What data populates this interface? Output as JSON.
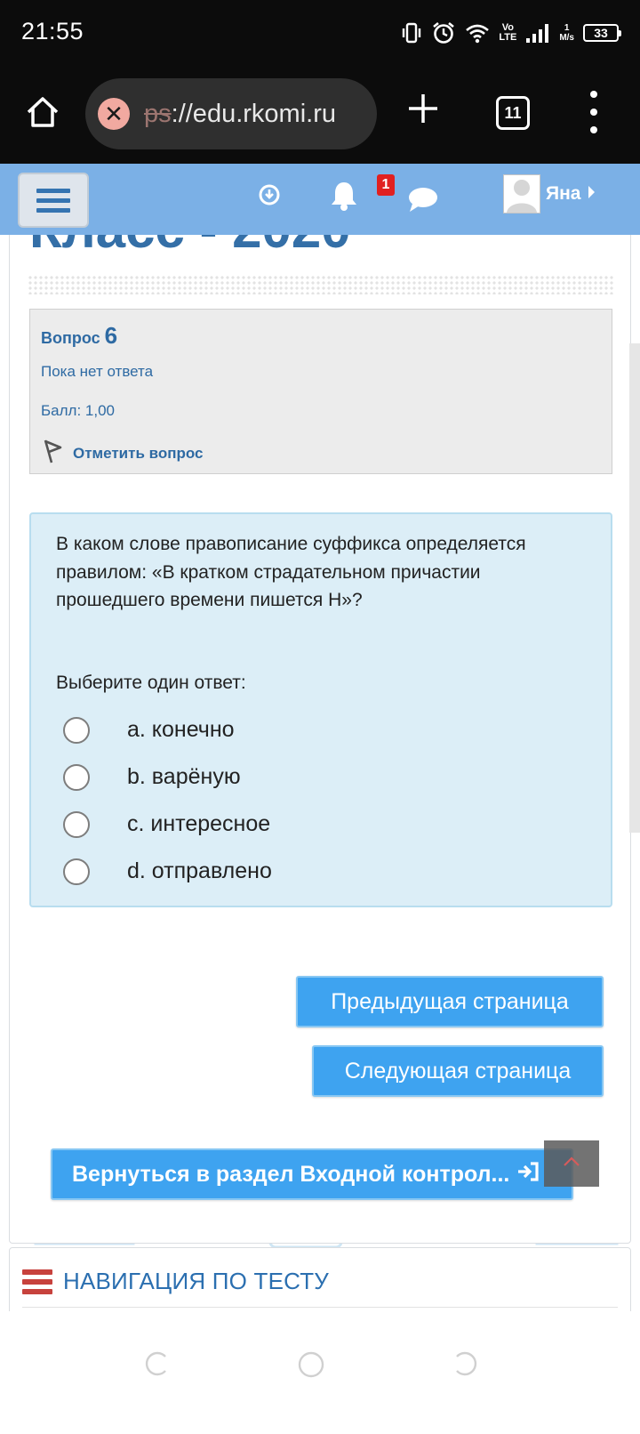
{
  "status_bar": {
    "time": "21:55",
    "network_label_top": "Vo",
    "network_label_bottom": "LTE",
    "speed_top": "1",
    "speed_bottom": "M/s",
    "battery": "33",
    "icons": [
      "vibrate-icon",
      "alarm-icon",
      "wifi-icon",
      "volte-icon",
      "signal-icon",
      "battery-icon"
    ]
  },
  "browser": {
    "url_scheme": "ps",
    "url_rest": "://edu.rkomi.ru",
    "tab_count": "11",
    "icons": [
      "home-icon",
      "connection-error-icon",
      "new-tab-icon",
      "tabs-icon",
      "menu-icon"
    ]
  },
  "navbar": {
    "notification_count": "1",
    "user_name": "Яна",
    "colors": {
      "background": "#7bb0e6",
      "badge": "#e12020"
    },
    "icons": [
      "hamburger-icon",
      "download-icon",
      "bell-icon",
      "chat-icon",
      "user-avatar-icon",
      "caret-right-icon"
    ]
  },
  "page": {
    "title": "Класс - 2020"
  },
  "question_info": {
    "label": "Вопрос",
    "number": "6",
    "status": "Пока нет ответа",
    "grade": "Балл: 1,00",
    "flag_label": "Отметить вопрос"
  },
  "question": {
    "text": "В каком слове правописание суффикса определяется правилом: «В кратком страдательном причастии прошедшего времени пишется Н»?",
    "prompt": "Выберите один ответ:",
    "answers": [
      {
        "label": "a. конечно"
      },
      {
        "label": "b. варёную"
      },
      {
        "label": "c. интересное"
      },
      {
        "label": "d. отправлено"
      }
    ]
  },
  "buttons": {
    "prev": "Предыдущая страница",
    "next": "Следующая страница",
    "return": "Вернуться в раздел Входной контрол..."
  },
  "quiz_nav": {
    "title": "НАВИГАЦИЯ ПО ТЕСТУ"
  },
  "colors": {
    "accent_button": "#3ea3f0",
    "link_text": "#2e6aa3",
    "question_bg": "#dceef7"
  }
}
